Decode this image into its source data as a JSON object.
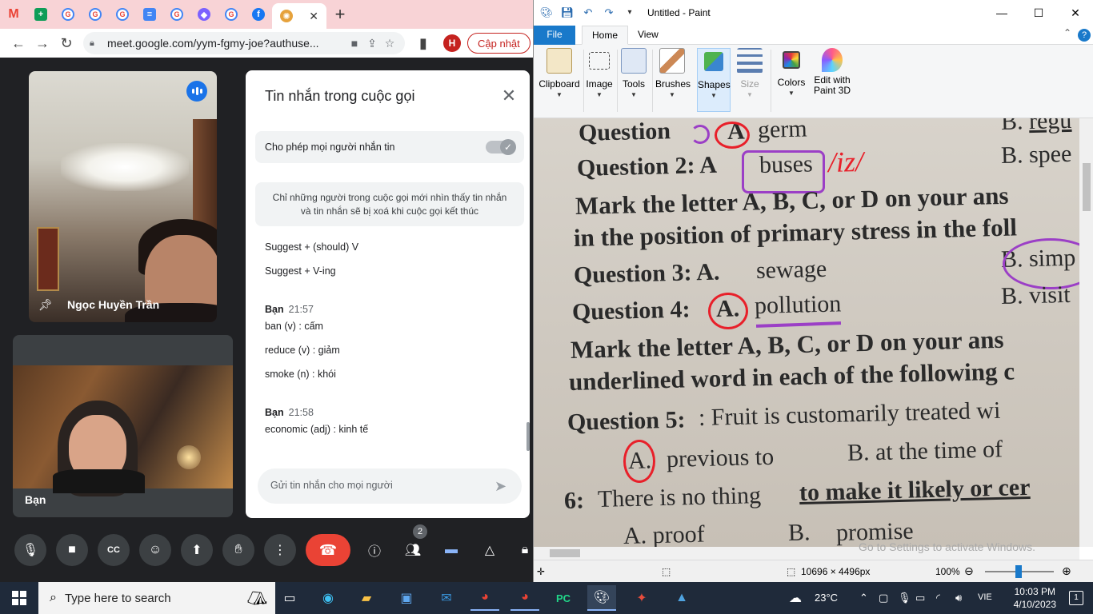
{
  "browser": {
    "tabs": [
      {
        "icon": "gmail-icon",
        "letter": "M",
        "color": "#ea4335"
      },
      {
        "icon": "sheets-icon",
        "letter": "+",
        "color": "#0f9d58"
      },
      {
        "icon": "google-icon",
        "letter": "G",
        "color": "#4285f4"
      },
      {
        "icon": "google-icon",
        "letter": "G",
        "color": "#4285f4"
      },
      {
        "icon": "google-icon",
        "letter": "G",
        "color": "#4285f4"
      },
      {
        "icon": "docs-icon",
        "letter": "≡",
        "color": "#4285f4"
      },
      {
        "icon": "google-icon",
        "letter": "G",
        "color": "#4285f4"
      },
      {
        "icon": "app-icon",
        "letter": "◆",
        "color": "#7b61ff"
      },
      {
        "icon": "google-icon",
        "letter": "G",
        "color": "#4285f4"
      },
      {
        "icon": "facebook-icon",
        "letter": "f",
        "color": "#1877f2"
      }
    ],
    "url": "meet.google.com/yym-fgmy-joe?authuse...",
    "profile_initial": "H",
    "update_label": "Cập nhật"
  },
  "meet": {
    "participant_name": "Ngọc Huyền Trần",
    "self_name": "Bạn",
    "people_count": "2",
    "chat": {
      "title": "Tin nhắn trong cuộc gọi",
      "allow_label": "Cho phép mọi người nhắn tin",
      "info_line1": "Chỉ những người trong cuộc gọi mới nhìn thấy tin nhắn",
      "info_line2": "và tin nhắn sẽ bị xoá khi cuộc gọi kết thúc",
      "messages": [
        "Suggest + (should) V",
        "Suggest + V-ing"
      ],
      "group1": {
        "sender": "Bạn",
        "time": "21:57",
        "lines": [
          "ban (v) : cấm",
          "reduce (v) : giảm",
          "smoke (n) : khói"
        ]
      },
      "group2": {
        "sender": "Bạn",
        "time": "21:58",
        "lines": [
          "economic (adj) : kinh tế"
        ]
      },
      "input_placeholder": "Gửi tin nhắn cho mọi người"
    }
  },
  "paint": {
    "title": "Untitled - Paint",
    "tabs": {
      "file": "File",
      "home": "Home",
      "view": "View"
    },
    "groups": {
      "clipboard": "Clipboard",
      "image": "Image",
      "tools": "Tools",
      "brushes": "Brushes",
      "shapes": "Shapes",
      "size": "Size",
      "colors": "Colors",
      "paint3d_1": "Edit with",
      "paint3d_2": "Paint 3D"
    },
    "image_size": "10696 × 4496px",
    "zoom": "100%",
    "watermark": "Go to Settings to activate Windows.",
    "photo": {
      "q1": "Question",
      "q1_ans": "A",
      "q1_word": "germ",
      "q1_right": "B.",
      "q1_right2": "regu",
      "q2": "Question 2: A",
      "q2_word": "buses",
      "q2_note": "/iz/",
      "q2_right": "B. spee",
      "mark1": "Mark the letter A, B, C, or D on your ans",
      "mark1b": "in the position of primary stress in the foll",
      "q3": "Question 3: A.",
      "q3_word": "sewage",
      "q3_right": "B.",
      "q3_right2": "simp",
      "q4": "Question 4:",
      "q4_ans": "A.",
      "q4_word": "pollution",
      "q4_right": "B. visit",
      "mark2": "Mark the letter A, B, C, or D on your ans",
      "mark2b": "underlined word in each of the following c",
      "q5": "Question 5:",
      "q5_text": ": Fruit is customarily treated wi",
      "q5_a": "A.",
      "q5_a_word": "previous   to",
      "q5_b": "B. at the time of",
      "q6": "6:",
      "q6_text": "There is no thing",
      "q6_under": "to make it likely or cer",
      "q6_a": "A. proof",
      "q6_b": "B.",
      "q6_b_word": "promise"
    }
  },
  "taskbar": {
    "search_placeholder": "Type here to search",
    "temperature": "23°C",
    "language": "VIE",
    "time": "10:03 PM",
    "date": "4/10/2023",
    "notification_count": "1"
  }
}
